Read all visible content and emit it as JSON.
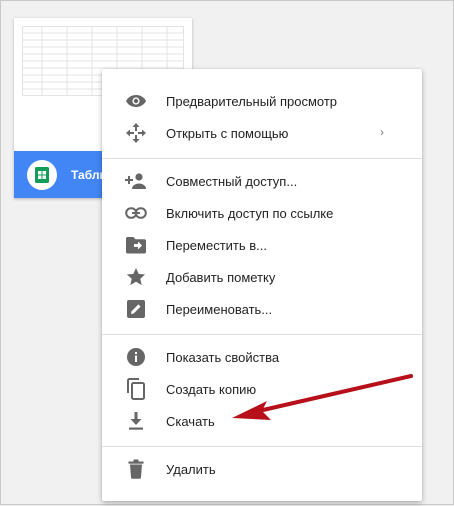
{
  "file_card": {
    "name": "Табли",
    "icon": "sheets-icon",
    "accent": "#4285f4",
    "sheets_green": "#0f9d58"
  },
  "context_menu": {
    "items": [
      {
        "label": "Предварительный просмотр",
        "icon": "eye-icon"
      },
      {
        "label": "Открыть с помощью",
        "icon": "move-icon",
        "has_submenu": true
      },
      {
        "label": "Совместный доступ...",
        "icon": "person-add-icon"
      },
      {
        "label": "Включить доступ по ссылке",
        "icon": "link-icon"
      },
      {
        "label": "Переместить в...",
        "icon": "folder-move-icon"
      },
      {
        "label": "Добавить пометку",
        "icon": "star-icon"
      },
      {
        "label": "Переименовать...",
        "icon": "edit-icon"
      },
      {
        "label": "Показать свойства",
        "icon": "info-icon"
      },
      {
        "label": "Создать копию",
        "icon": "copy-icon"
      },
      {
        "label": "Скачать",
        "icon": "download-icon"
      },
      {
        "label": "Удалить",
        "icon": "trash-icon"
      }
    ],
    "submenu_glyph": "›"
  },
  "annotation": {
    "arrow_color": "#b8101a",
    "points_to": "Скачать"
  }
}
